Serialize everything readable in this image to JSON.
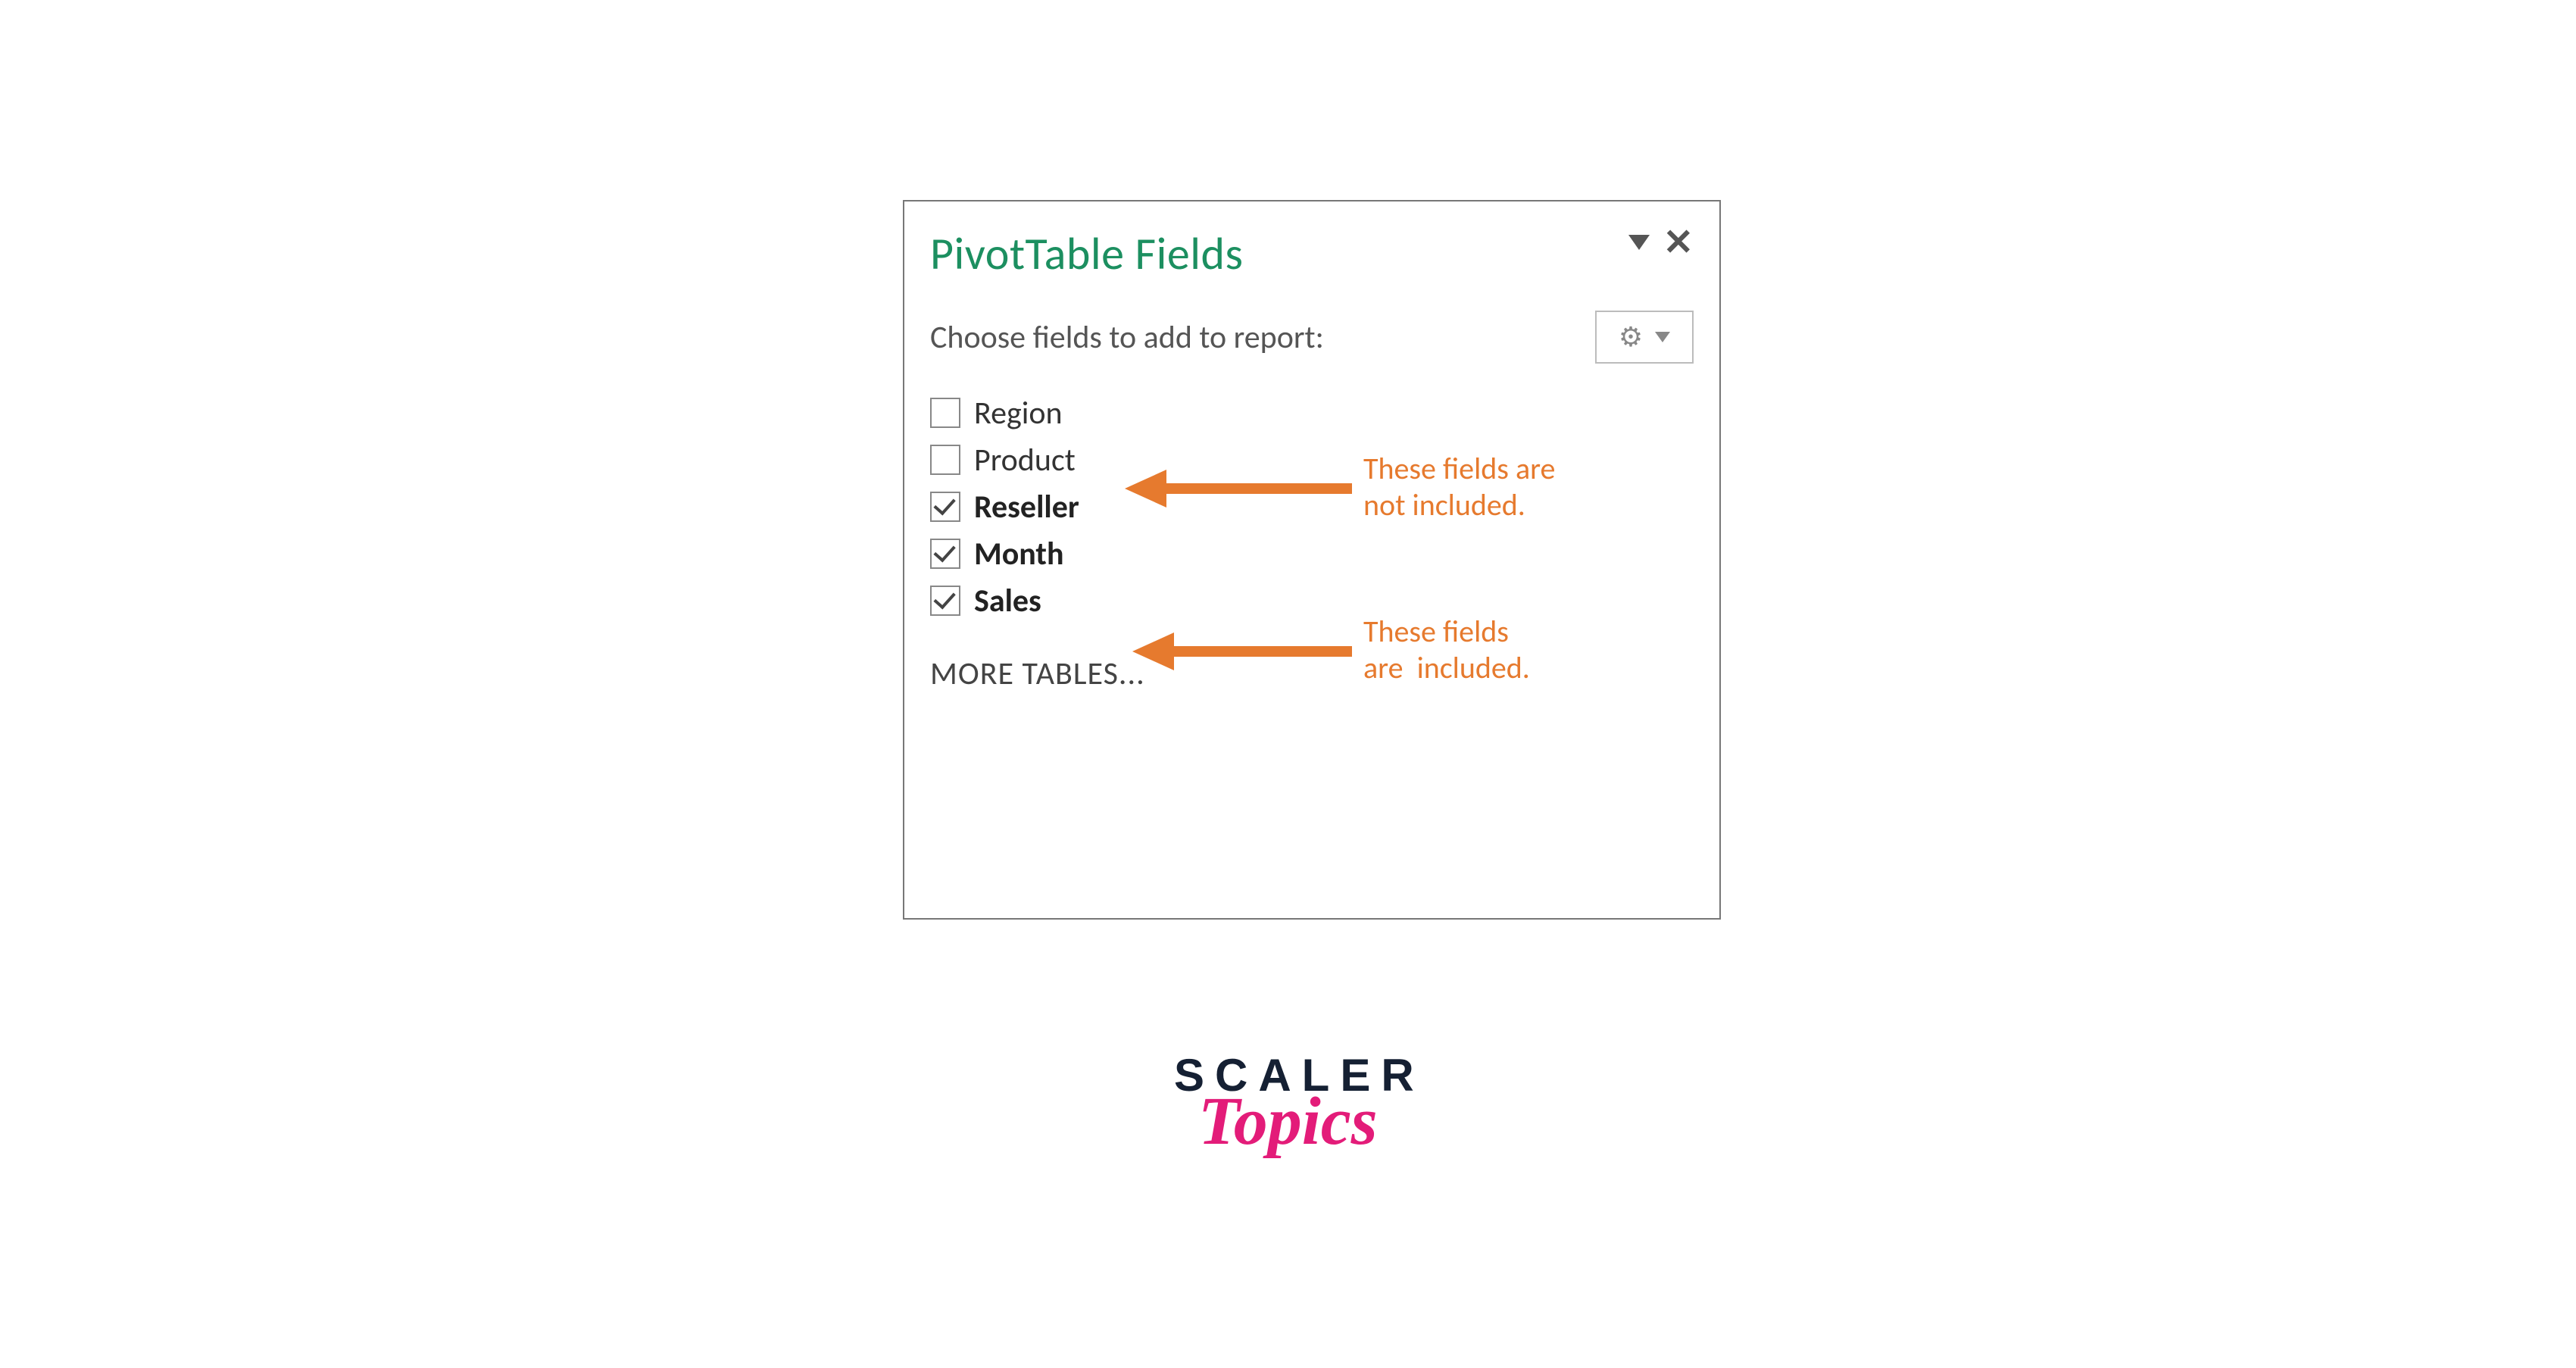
{
  "panel": {
    "title": "PivotTable Fields",
    "subtitle": "Choose fields to add to report:",
    "more_tables": "MORE TABLES..."
  },
  "fields": [
    {
      "label": "Region",
      "checked": false
    },
    {
      "label": "Product",
      "checked": false
    },
    {
      "label": "Reseller",
      "checked": true
    },
    {
      "label": "Month",
      "checked": true
    },
    {
      "label": "Sales",
      "checked": true
    }
  ],
  "annotations": {
    "not_included": "These fields are\nnot included.",
    "included": "These fields\nare  included."
  },
  "logo": {
    "line1": "SCALER",
    "line2": "Topics"
  },
  "colors": {
    "accent_green": "#1c8f60",
    "annotation_orange": "#e67a2e",
    "brand_pink": "#e31c79",
    "brand_navy": "#152033"
  }
}
